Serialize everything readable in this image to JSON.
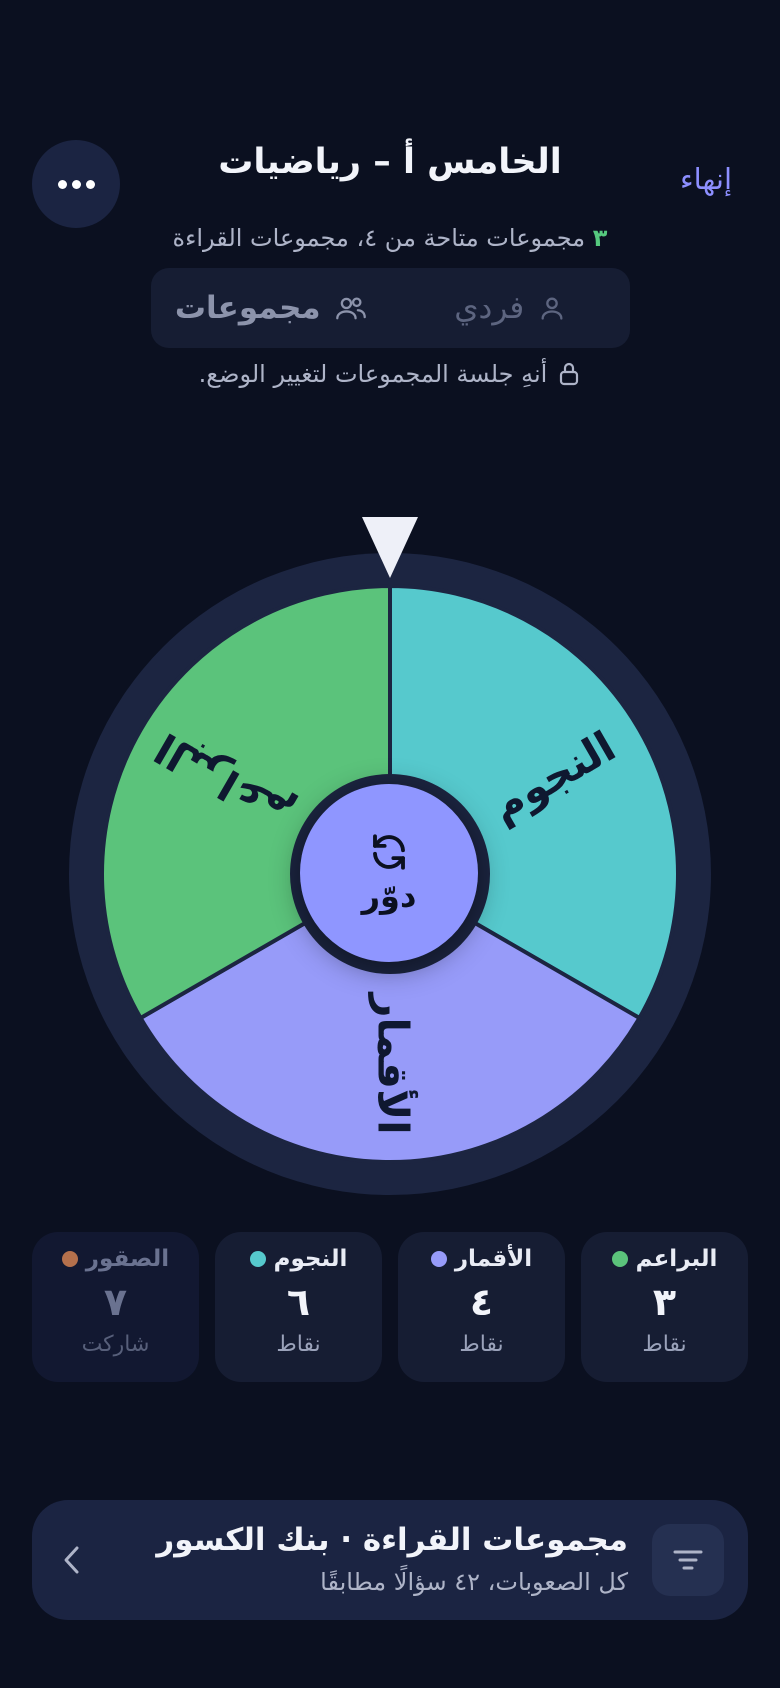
{
  "header": {
    "title": "الخامس أ – رياضيات",
    "end_label": "إنهاء",
    "more_icon": "more-horizontal-icon"
  },
  "subtitle": {
    "count": "٣",
    "text": "مجموعات متاحة من ٤، مجموعات القراءة"
  },
  "mode_toggle": {
    "individual_label": "فردي",
    "individual_icon": "user-icon",
    "groups_label": "مجموعات",
    "groups_icon": "users-icon",
    "selected": "مجموعات"
  },
  "lock_note": {
    "text": "أنهِ جلسة المجموعات لتغيير الوضع.",
    "icon": "lock-icon"
  },
  "wheel": {
    "segments": [
      {
        "label": "النجوم",
        "color": "#56c9cd"
      },
      {
        "label": "الأقمار",
        "color": "#979bf9"
      },
      {
        "label": "البراعم",
        "color": "#5bc37b"
      }
    ],
    "rim_color": "#1c2541",
    "pointer_color": "#eef0f8",
    "spin_label": "دوّر",
    "spin_icon": "refresh-icon",
    "spin_color": "#8f96ff"
  },
  "groups": [
    {
      "name": "البراعم",
      "color": "#5bc37b",
      "score": "٣",
      "unit": "نقاط",
      "dim": false
    },
    {
      "name": "الأقمار",
      "color": "#979bf9",
      "score": "٤",
      "unit": "نقاط",
      "dim": false
    },
    {
      "name": "النجوم",
      "color": "#56c9cd",
      "score": "٦",
      "unit": "نقاط",
      "dim": false
    },
    {
      "name": "الصقور",
      "color": "#b4704c",
      "score": "٧",
      "unit": "شاركت",
      "dim": true
    }
  ],
  "bottom_bar": {
    "title": "مجموعات القراءة · بنك الكسور",
    "subtitle": "كل الصعوبات، ٤٢ سؤالًا مطابقًا",
    "filter_icon": "filter-icon",
    "chevron_icon": "chevron-left-icon"
  }
}
